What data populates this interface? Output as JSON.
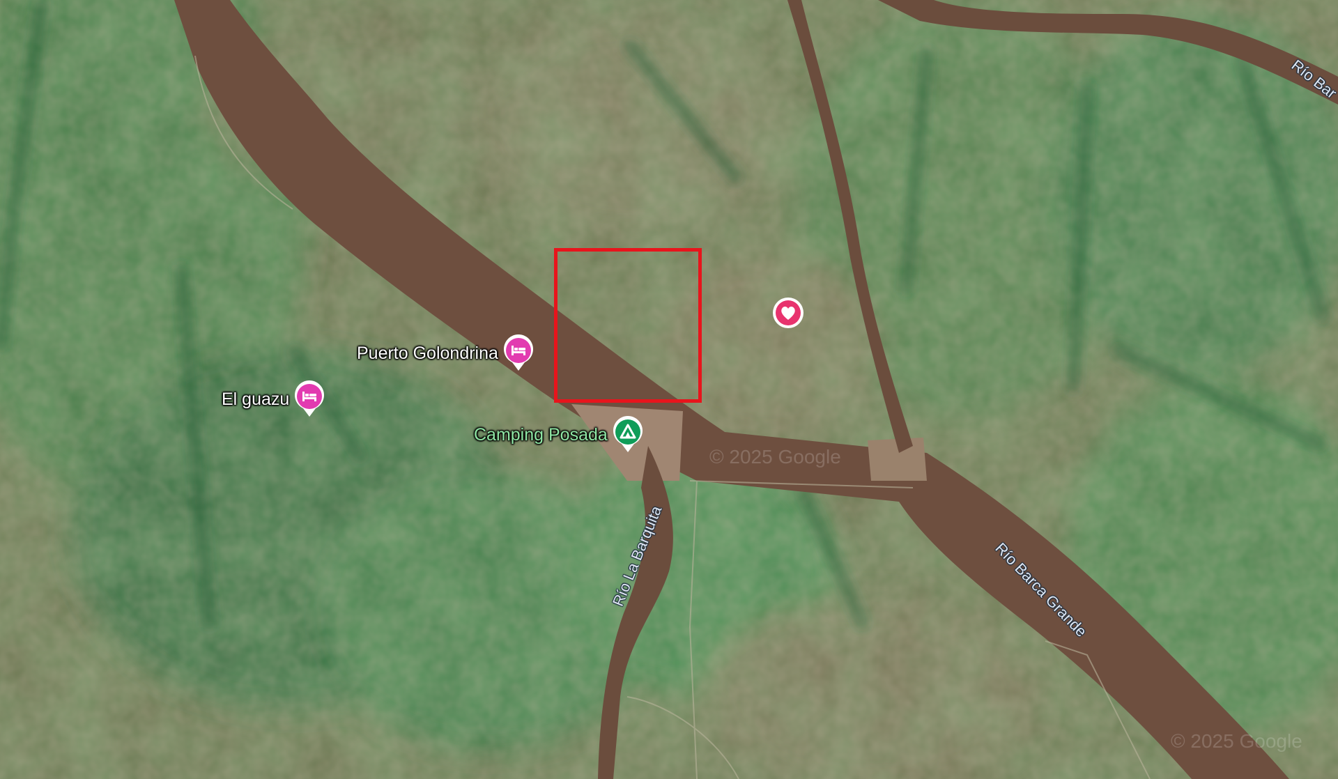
{
  "map": {
    "places": [
      {
        "name": "Puerto Golondrina",
        "type": "hotel",
        "icon": "bed-icon",
        "color": "#e23bb0"
      },
      {
        "name": "El guazu",
        "type": "hotel",
        "icon": "bed-icon",
        "color": "#e23bb0"
      },
      {
        "name": "Camping Posada",
        "type": "campground",
        "icon": "tent-icon",
        "color": "#0f9d58"
      }
    ],
    "rivers": [
      {
        "name": "Río La Barquita"
      },
      {
        "name": "Río Barca Grande"
      },
      {
        "name": "Río Bar"
      }
    ],
    "saved_place": {
      "icon": "heart-icon",
      "color": "#e8336e"
    },
    "selection_color": "#e8141c",
    "watermarks": [
      "© 2025 Google",
      "© 2025 Google"
    ]
  }
}
